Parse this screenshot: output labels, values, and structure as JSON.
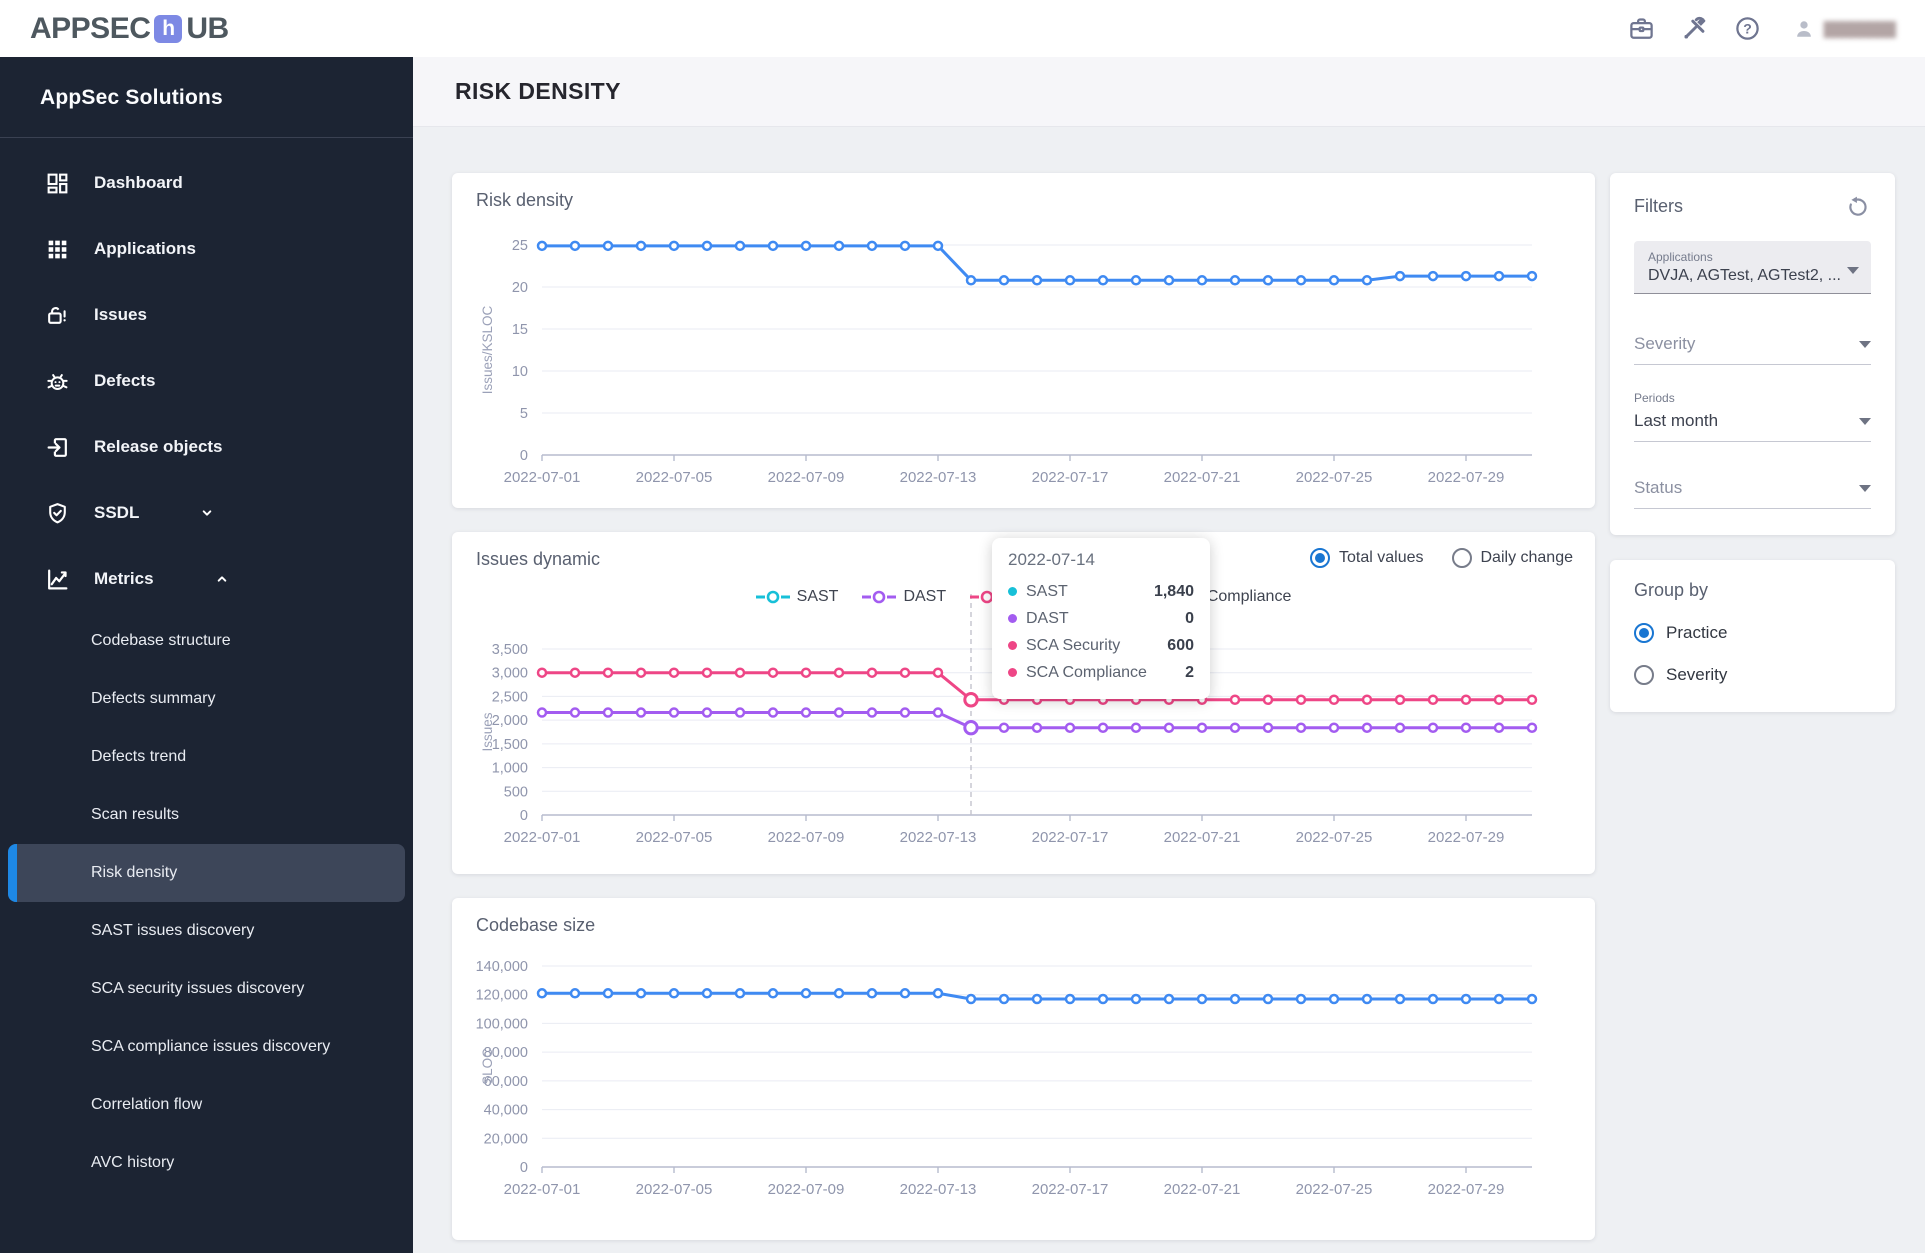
{
  "topbar": {
    "logo_prefix": "APPSEC",
    "logo_h": "h",
    "logo_suffix": "UB",
    "username_masked": "████████"
  },
  "sidebar": {
    "title": "AppSec Solutions",
    "items": [
      {
        "label": "Dashboard",
        "icon": "dashboard-icon"
      },
      {
        "label": "Applications",
        "icon": "apps-icon"
      },
      {
        "label": "Issues",
        "icon": "lock-alert-icon"
      },
      {
        "label": "Defects",
        "icon": "bug-icon"
      },
      {
        "label": "Release objects",
        "icon": "exit-icon"
      },
      {
        "label": "SSDL",
        "icon": "shield-check-icon",
        "chevron": "down"
      },
      {
        "label": "Metrics",
        "icon": "chart-icon",
        "chevron": "up"
      }
    ],
    "metrics_children": [
      {
        "label": "Codebase structure",
        "selected": false
      },
      {
        "label": "Defects summary",
        "selected": false
      },
      {
        "label": "Defects trend",
        "selected": false
      },
      {
        "label": "Scan results",
        "selected": false
      },
      {
        "label": "Risk density",
        "selected": true
      },
      {
        "label": "SAST issues discovery",
        "selected": false
      },
      {
        "label": "SCA security issues discovery",
        "selected": false
      },
      {
        "label": "SCA compliance issues discovery",
        "selected": false
      },
      {
        "label": "Correlation flow",
        "selected": false
      },
      {
        "label": "AVC history",
        "selected": false
      }
    ]
  },
  "page": {
    "title": "RISK DENSITY"
  },
  "issues_controls": {
    "options": [
      {
        "label": "Total values",
        "selected": true
      },
      {
        "label": "Daily change",
        "selected": false
      }
    ]
  },
  "filters": {
    "title": "Filters",
    "applications": {
      "label": "Applications",
      "value": "DVJA, AGTest, AGTest2, ..."
    },
    "severity": {
      "placeholder": "Severity"
    },
    "periods": {
      "label": "Periods",
      "value": "Last month"
    },
    "status": {
      "placeholder": "Status"
    }
  },
  "group_by": {
    "title": "Group by",
    "options": [
      {
        "label": "Practice",
        "selected": true
      },
      {
        "label": "Severity",
        "selected": false
      }
    ]
  },
  "colors": {
    "blue_line": "#3f8af2",
    "cyan": "#17c0d8",
    "purple": "#a35cf0",
    "pink": "#ee4686",
    "accent": "#1976d2",
    "grid": "#e9ebf3",
    "axis": "#b7bbce",
    "tick_text": "#8f95ac"
  },
  "x_dates": [
    "2022-07-01",
    "2022-07-02",
    "2022-07-03",
    "2022-07-04",
    "2022-07-05",
    "2022-07-06",
    "2022-07-07",
    "2022-07-08",
    "2022-07-09",
    "2022-07-10",
    "2022-07-11",
    "2022-07-12",
    "2022-07-13",
    "2022-07-14",
    "2022-07-15",
    "2022-07-16",
    "2022-07-17",
    "2022-07-18",
    "2022-07-19",
    "2022-07-20",
    "2022-07-21",
    "2022-07-22",
    "2022-07-23",
    "2022-07-24",
    "2022-07-25",
    "2022-07-26",
    "2022-07-27",
    "2022-07-28",
    "2022-07-29",
    "2022-07-30",
    "2022-07-31"
  ],
  "xtick_indices": [
    0,
    4,
    8,
    12,
    16,
    20,
    24,
    28
  ],
  "chart_data": [
    {
      "type": "line",
      "title": "Risk density",
      "ylabel": "Issues/KSLOC",
      "ylim": [
        0,
        25
      ],
      "ytick_step": 5,
      "series": [
        {
          "name": "Risk density",
          "color": "#3f8af2",
          "values": [
            24.9,
            24.9,
            24.9,
            24.9,
            24.9,
            24.9,
            24.9,
            24.9,
            24.9,
            24.9,
            24.9,
            24.9,
            24.9,
            20.8,
            20.8,
            20.8,
            20.8,
            20.8,
            20.8,
            20.8,
            20.8,
            20.8,
            20.8,
            20.8,
            20.8,
            20.8,
            21.3,
            21.3,
            21.3,
            21.3,
            21.3
          ]
        }
      ]
    },
    {
      "type": "line",
      "title": "Issues dynamic",
      "ylabel": "Issues",
      "ylim": [
        0,
        3500
      ],
      "ytick_step": 500,
      "legend": [
        {
          "label": "SAST",
          "color": "#17c0d8"
        },
        {
          "label": "DAST",
          "color": "#a35cf0"
        },
        {
          "label": "SCA Security",
          "color": "#ee4686"
        },
        {
          "label": "SCA Compliance",
          "color": "#ee4686"
        }
      ],
      "emphasis_index": 13,
      "series": [
        {
          "name": "SCA Security",
          "color": "#ee4686",
          "values": [
            3000,
            3000,
            3000,
            3000,
            3000,
            3000,
            3000,
            3000,
            3000,
            3000,
            3000,
            3000,
            3000,
            2430,
            2430,
            2430,
            2430,
            2430,
            2430,
            2430,
            2430,
            2430,
            2430,
            2430,
            2430,
            2430,
            2430,
            2430,
            2430,
            2430,
            2430
          ]
        },
        {
          "name": "DAST",
          "color": "#a35cf0",
          "values": [
            2160,
            2160,
            2160,
            2160,
            2160,
            2160,
            2160,
            2160,
            2160,
            2160,
            2160,
            2160,
            2160,
            1840,
            1840,
            1840,
            1840,
            1840,
            1840,
            1840,
            1840,
            1840,
            1840,
            1840,
            1840,
            1840,
            1840,
            1840,
            1840,
            1840,
            1840
          ]
        }
      ],
      "tooltip": {
        "date": "2022-07-14",
        "rows": [
          {
            "label": "SAST",
            "value": "1,840",
            "color": "#17c0d8"
          },
          {
            "label": "DAST",
            "value": "0",
            "color": "#a35cf0"
          },
          {
            "label": "SCA Security",
            "value": "600",
            "color": "#ee4686"
          },
          {
            "label": "SCA Compliance",
            "value": "2",
            "color": "#ee4686"
          }
        ]
      }
    },
    {
      "type": "line",
      "title": "Codebase size",
      "ylabel": "SLOC",
      "ylim": [
        0,
        140000
      ],
      "ytick_step": 20000,
      "series": [
        {
          "name": "SLOC",
          "color": "#3f8af2",
          "values": [
            121000,
            121000,
            121000,
            121000,
            121000,
            121000,
            121000,
            121000,
            121000,
            121000,
            121000,
            121000,
            121000,
            117000,
            117000,
            117000,
            117000,
            117000,
            117000,
            117000,
            117000,
            117000,
            117000,
            117000,
            117000,
            117000,
            117000,
            117000,
            117000,
            117000,
            117000
          ]
        }
      ]
    }
  ]
}
